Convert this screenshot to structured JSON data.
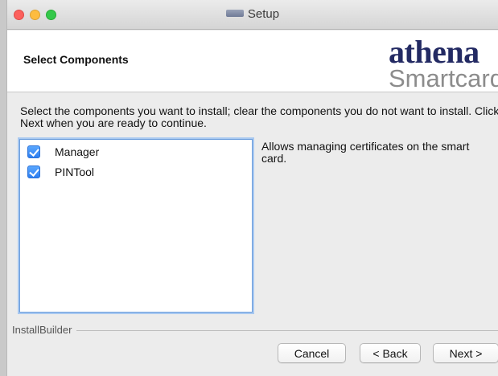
{
  "window": {
    "title": "Setup"
  },
  "header": {
    "title": "Select Components",
    "logo_line1": "athena",
    "logo_line2": "Smartcard"
  },
  "instructions": "Select the components you want to install; clear the components you do not want to install. Click Next when you are ready to continue.",
  "components": [
    {
      "label": "Manager",
      "checked": true
    },
    {
      "label": "PINTool",
      "checked": true
    }
  ],
  "description": "Allows managing certificates on the smart card.",
  "footer": {
    "brand": "InstallBuilder"
  },
  "buttons": {
    "cancel": "Cancel",
    "back": "< Back",
    "next": "Next >"
  },
  "colors": {
    "logo_primary": "#232a63",
    "logo_secondary": "#8c8c8c",
    "checkbox": "#2d7ef1",
    "list_focus": "#6d9edc"
  }
}
